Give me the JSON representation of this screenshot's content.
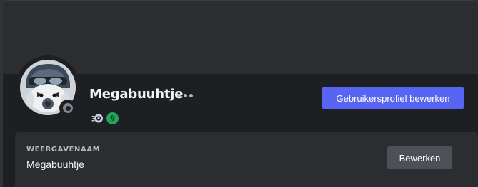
{
  "profile": {
    "username": "Megabuuhtje",
    "status": "offline",
    "badges": [
      {
        "icon": "nitro-boost-icon"
      },
      {
        "icon": "hashtag-icon",
        "glyph": "#"
      }
    ],
    "edit_profile_label": "Gebruikersprofiel bewerken"
  },
  "display_name": {
    "label": "WEERGAVENAAM",
    "value": "Megabuuhtje",
    "edit_label": "Bewerken"
  },
  "colors": {
    "accent": "#5865f2",
    "background": "#313338",
    "card": "#1e1f22",
    "panel": "#2b2d31",
    "secondary_button": "#4e5058",
    "badge_green": "#23a55a"
  }
}
